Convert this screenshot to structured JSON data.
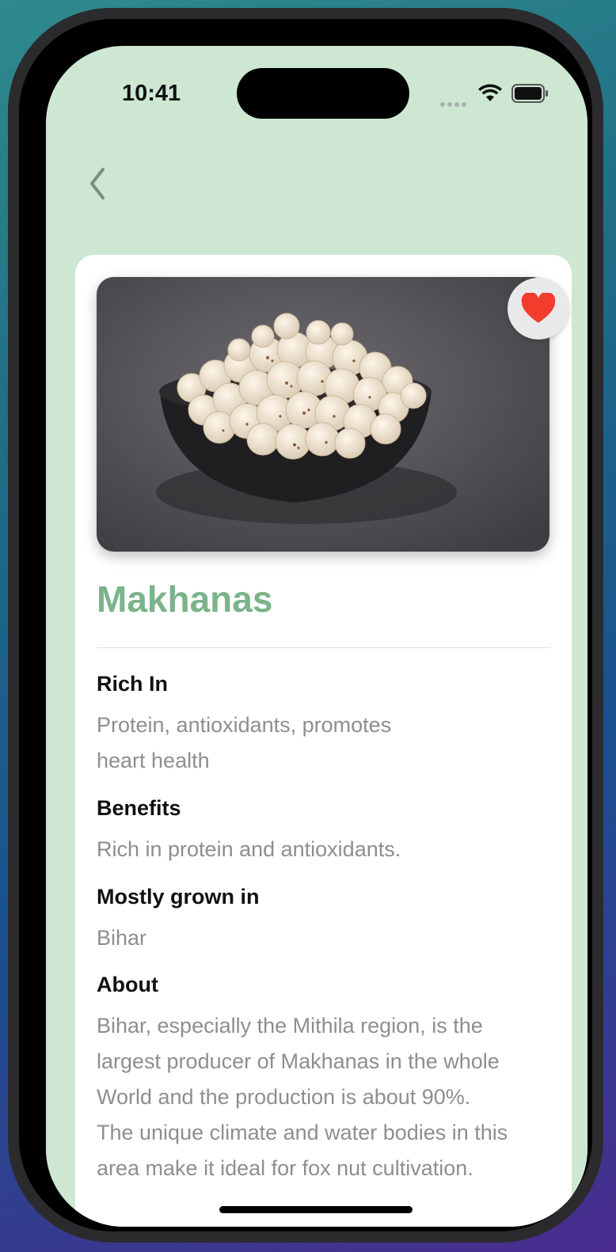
{
  "status_bar": {
    "time": "10:41"
  },
  "nav": {
    "back_icon": "chevron-left-icon"
  },
  "product": {
    "name": "Makhanas",
    "favorite_icon": "heart-icon",
    "favorite_color": "#f23c2c",
    "image_alt": "Bowl of makhanas"
  },
  "sections": [
    {
      "label": "Rich In",
      "text": "Protein, antioxidants, promotes\nheart health"
    },
    {
      "label": "Benefits",
      "text": "Rich in protein and antioxidants."
    },
    {
      "label": "Mostly grown in",
      "text": "Bihar"
    },
    {
      "label": "About",
      "text": "Bihar, especially the Mithila region, is the\nlargest producer of Makhanas in the whole\nWorld and the production is about 90%.\nThe unique climate and water bodies in this\narea make it ideal for fox nut cultivation."
    }
  ],
  "colors": {
    "background": "#cde7d3",
    "title": "#7bb38a",
    "body_text": "#8e8e8e"
  }
}
